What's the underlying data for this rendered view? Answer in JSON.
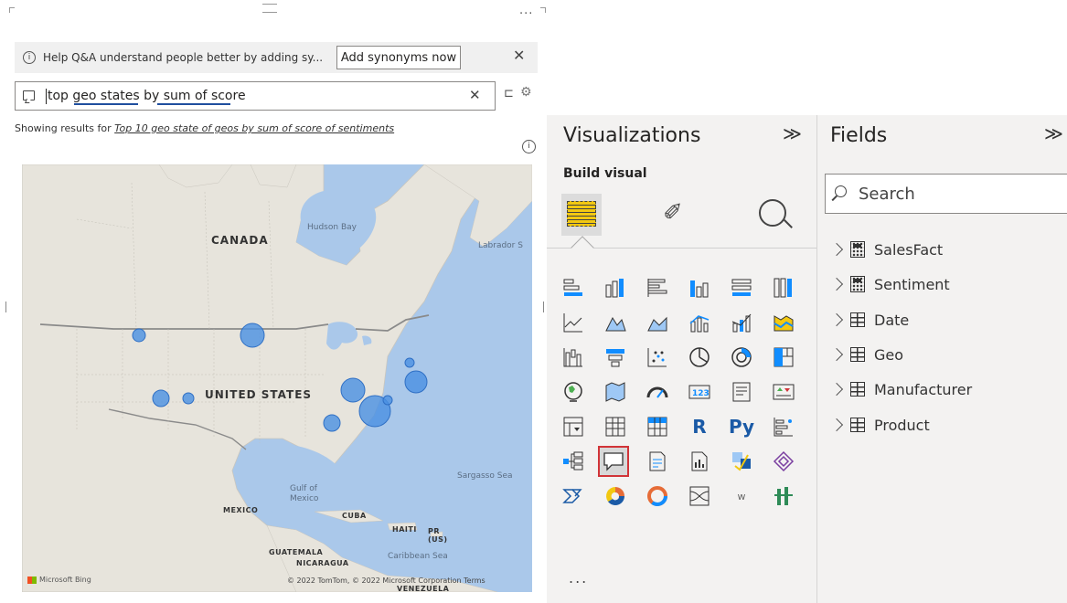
{
  "qa": {
    "banner_text": "Help Q&A understand people better by adding sy...",
    "add_synonyms_label": "Add synonyms now",
    "close_glyph": "✕",
    "more_glyph": "...",
    "question_text": "top geo states by sum of score",
    "clear_glyph": "✕",
    "results_prefix": "Showing results for ",
    "results_link": "Top 10 geo state of geos by sum of score of sentiments"
  },
  "map": {
    "labels": {
      "hudson_bay": "Hudson Bay",
      "canada": "CANADA",
      "labrador": "Labrador S",
      "united_states": "UNITED STATES",
      "gulf": "Gulf of\nMexico",
      "mexico": "MEXICO",
      "cuba": "CUBA",
      "haiti": "HAITI",
      "pr": "PR\n(US)",
      "sargasso": "Sargasso Sea",
      "guatemala": "GUATEMALA",
      "nicaragua": "NICARAGUA",
      "caribbean": "Caribbean Sea",
      "venezuela": "VENEZUELA"
    },
    "bing": "Microsoft Bing",
    "copyright": "© 2022 TomTom, © 2022 Microsoft Corporation  Terms",
    "bubble_color": "#4a90e2"
  },
  "visualizations": {
    "title": "Visualizations",
    "collapse_glyph": "≫",
    "build_label": "Build visual",
    "r_label": "R",
    "py_label": "Py",
    "w_label": "w",
    "ellipsis": "...",
    "selected_visual": "qa-visual-icon",
    "accent": "#f2c811",
    "selected_border": "#d13438"
  },
  "fields": {
    "title": "Fields",
    "collapse_glyph": "≫",
    "search_placeholder": "Search",
    "items": [
      {
        "label": "SalesFact",
        "icon": "calculator-table-icon"
      },
      {
        "label": "Sentiment",
        "icon": "calculator-table-icon"
      },
      {
        "label": "Date",
        "icon": "table-icon"
      },
      {
        "label": "Geo",
        "icon": "table-icon"
      },
      {
        "label": "Manufacturer",
        "icon": "table-icon"
      },
      {
        "label": "Product",
        "icon": "table-icon"
      }
    ]
  }
}
